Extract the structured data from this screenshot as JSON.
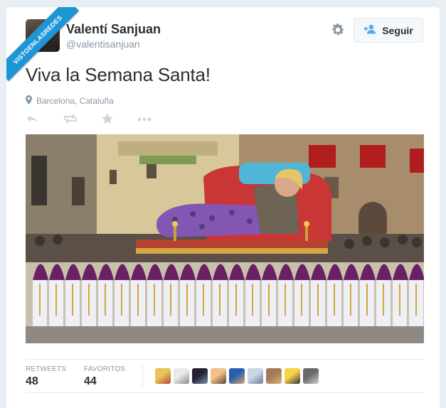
{
  "watermark": {
    "text": "VISTOENLASREDES"
  },
  "user": {
    "name": "Valentí Sanjuan",
    "handle": "@valentisanjuan"
  },
  "follow_button": {
    "label": "Seguir",
    "icon": "add-user-icon"
  },
  "tweet": {
    "text": "Viva la Semana Santa!",
    "location": "Barcelona, Cataluña"
  },
  "actions": [
    {
      "icon": "reply-icon"
    },
    {
      "icon": "retweet-icon"
    },
    {
      "icon": "favorite-star-icon"
    },
    {
      "icon": "more-icon"
    }
  ],
  "stats": {
    "retweets_label": "RETWEETS",
    "retweets_value": "48",
    "favorites_label": "FAVORITOS",
    "favorites_value": "44"
  },
  "favoriters_count_shown": 9,
  "colors": {
    "accent": "#1d96d6",
    "text_muted": "#8899a6",
    "text_main": "#292f33",
    "robes_purple": "#6a1f66"
  }
}
